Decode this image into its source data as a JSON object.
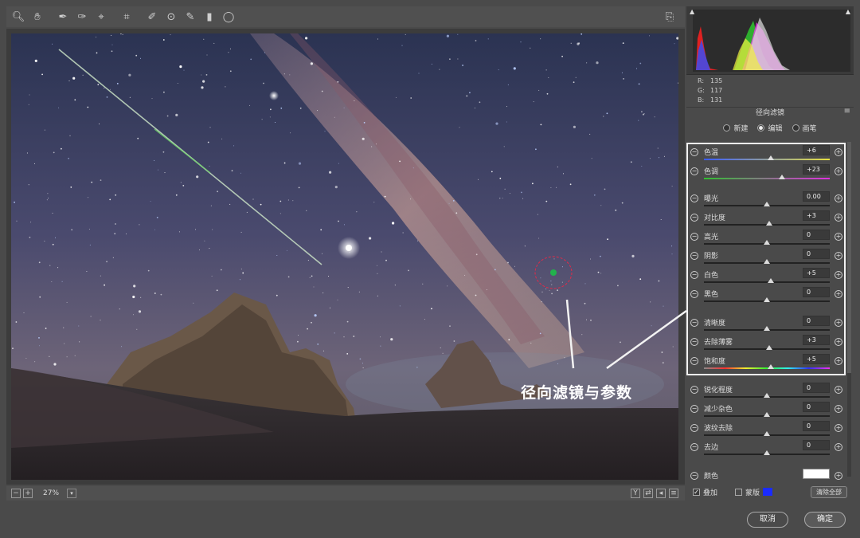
{
  "toolbar": {
    "tools": [
      "zoom-icon",
      "hand-icon",
      "white-balance-icon",
      "color-sampler-icon",
      "target-adjust-icon",
      "crop-icon",
      "spot-removal-icon",
      "red-eye-icon",
      "brush-icon",
      "graduated-filter-icon",
      "radial-filter-icon"
    ]
  },
  "histogram": {
    "r": "135",
    "g": "117",
    "b": "131",
    "r_label": "R:",
    "g_label": "G:",
    "b_label": "B:"
  },
  "panel": {
    "title": "径向滤镜",
    "modes": [
      {
        "label": "新建",
        "selected": false
      },
      {
        "label": "编辑",
        "selected": true
      },
      {
        "label": "画笔",
        "selected": false
      }
    ],
    "sliders": [
      {
        "label": "色温",
        "value": "+6",
        "pos": 0.53
      },
      {
        "label": "色调",
        "value": "+23",
        "pos": 0.62
      },
      {
        "label": "曝光",
        "value": "0.00",
        "pos": 0.5
      },
      {
        "label": "对比度",
        "value": "+3",
        "pos": 0.52
      },
      {
        "label": "高光",
        "value": "0",
        "pos": 0.5
      },
      {
        "label": "阴影",
        "value": "0",
        "pos": 0.5
      },
      {
        "label": "白色",
        "value": "+5",
        "pos": 0.53
      },
      {
        "label": "黑色",
        "value": "0",
        "pos": 0.5
      },
      {
        "label": "清晰度",
        "value": "0",
        "pos": 0.5
      },
      {
        "label": "去除薄雾",
        "value": "+3",
        "pos": 0.52
      },
      {
        "label": "饱和度",
        "value": "+5",
        "pos": 0.53
      },
      {
        "label": "锐化程度",
        "value": "0",
        "pos": 0.5
      },
      {
        "label": "减少杂色",
        "value": "0",
        "pos": 0.5
      },
      {
        "label": "波纹去除",
        "value": "0",
        "pos": 0.5
      },
      {
        "label": "去边",
        "value": "0",
        "pos": 0.5
      }
    ],
    "color_label": "颜色",
    "overlay_label": "叠加",
    "mask_label": "蒙版",
    "clear_all_label": "清除全部"
  },
  "status": {
    "zoom": "27%"
  },
  "footer": {
    "cancel_label": "取消",
    "ok_label": "确定"
  },
  "annotation": "径向滤镜与参数",
  "colors": {
    "highlight": "#f2f2f2",
    "mask_color": "#1a2bff",
    "pin": "#22b14c"
  }
}
